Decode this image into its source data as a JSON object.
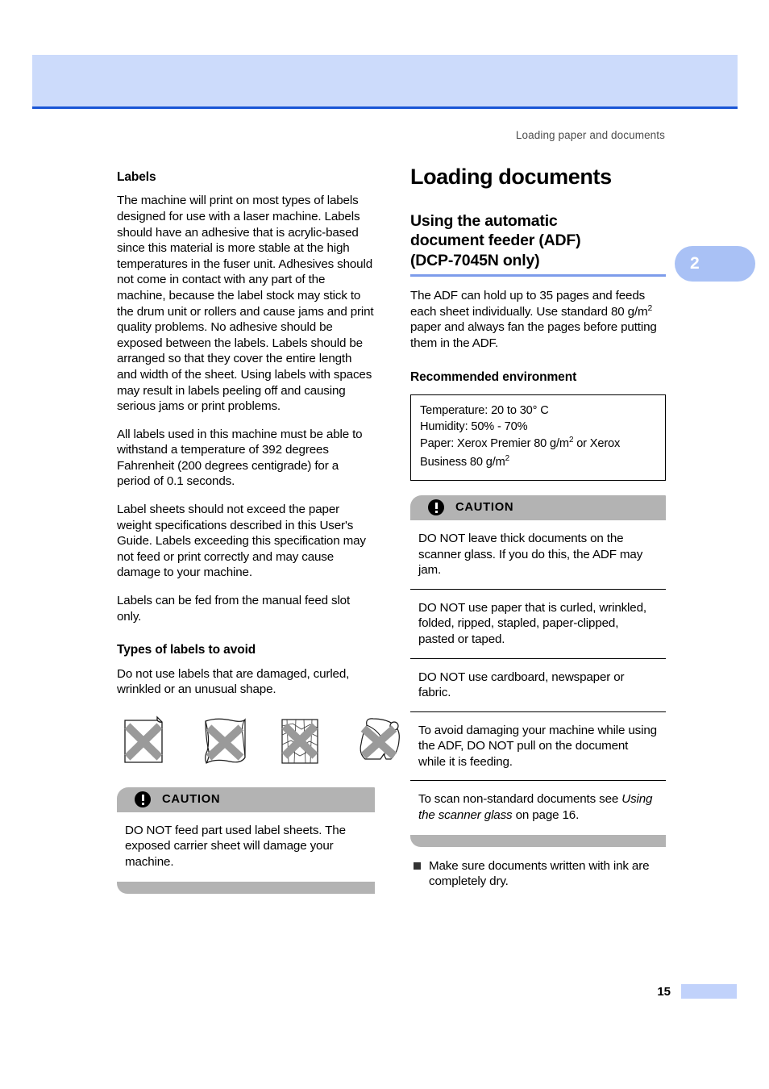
{
  "banner": {
    "accent_color": "#ccdbfb",
    "rule_color": "#1a56d6"
  },
  "running_header": "Loading paper and documents",
  "chapter_badge": {
    "number": "2",
    "color": "#a9c1f5"
  },
  "left_column": {
    "heading": "Labels",
    "paragraphs": [
      "The machine will print on most types of labels designed for use with a laser machine. Labels should have an adhesive that is acrylic-based since this material is more stable at the high temperatures in the fuser unit. Adhesives should not come in contact with any part of the machine, because the label stock may stick to the drum unit or rollers and cause jams and print quality problems. No adhesive should be exposed between the labels. Labels should be arranged so that they cover the entire length and width of the sheet. Using labels with spaces may result in labels peeling off and causing serious jams or print problems.",
      "All labels used in this machine must be able to withstand a temperature of 392 degrees Fahrenheit (200 degrees centigrade) for a period of 0.1 seconds.",
      "Label sheets should not exceed the paper weight specifications described in this User's Guide. Labels exceeding this specification may not feed or print correctly and may cause damage to your machine.",
      "Labels can be fed from the manual feed slot only."
    ],
    "avoid_heading": "Types of labels to avoid",
    "avoid_text": "Do not use labels that are damaged, curled, wrinkled or an unusual shape.",
    "figures": [
      "label-sheet-curled-corner-icon",
      "label-sheet-curled-icon",
      "label-sheet-wrinkled-icon",
      "label-sheet-unusual-shape-icon"
    ],
    "caution": {
      "label": "CAUTION",
      "items": [
        "DO NOT feed part used label sheets. The exposed carrier sheet will damage your machine."
      ]
    }
  },
  "right_column": {
    "title": "Loading documents",
    "section_title_line1": "Using the automatic",
    "section_title_line2": "document feeder (ADF)",
    "section_title_line3": " (DCP-7045N only)",
    "intro_line1": "The ADF can hold up to 35 pages and feeds",
    "intro_line2": "each sheet individually. Use standard",
    "intro_line3_pre": "80 g/m",
    "intro_line3_sup": "2",
    "intro_line3_post": " paper and always fan the pages",
    "intro_line4": "before putting them in the ADF.",
    "env_heading": "Recommended environment",
    "env_lines": {
      "temperature": "Temperature: 20 to 30° C",
      "humidity": "Humidity: 50% - 70%",
      "paper_pre": "Paper: Xerox Premier 80 g/m",
      "paper_sup": "2",
      "paper_post": " or Xerox",
      "business_pre": "Business 80 g/m",
      "business_sup": "2"
    },
    "caution": {
      "label": "CAUTION",
      "items": [
        "DO NOT leave thick documents on the scanner glass. If you do this, the ADF may jam.",
        "DO NOT use paper that is curled, wrinkled, folded, ripped, stapled, paper-clipped, pasted or taped.",
        "DO NOT use cardboard, newspaper or fabric."
      ],
      "item_4": "To avoid damaging your machine while using the ADF, DO NOT pull on the document while it is feeding.",
      "item_5_pre": "To scan non-standard documents see ",
      "item_5_em": "Using the scanner glass",
      "item_5_post": " on page 16."
    },
    "bullet_note": "Make sure documents written with ink are completely dry."
  },
  "footer": {
    "page_number": "15",
    "swatch_color": "#c1d2fb"
  }
}
